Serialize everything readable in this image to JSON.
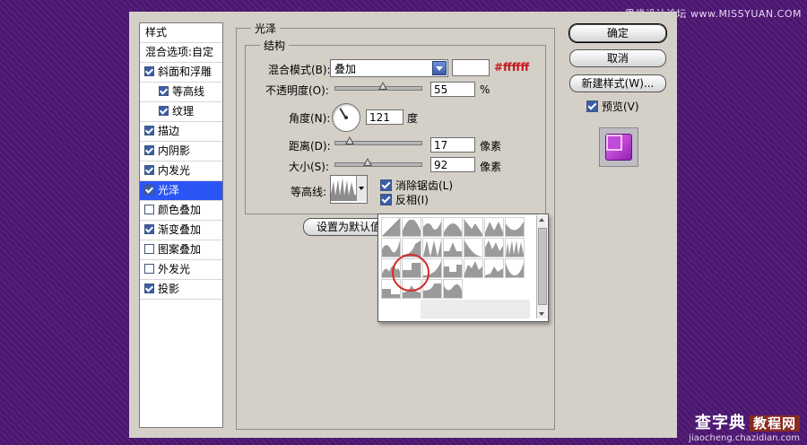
{
  "dialog": {
    "style_list": {
      "header": "样式",
      "blend_options": "混合选项:自定",
      "items": [
        {
          "label": "斜面和浮雕",
          "checked": true,
          "indent": false,
          "selected": false
        },
        {
          "label": "等高线",
          "checked": true,
          "indent": true,
          "selected": false
        },
        {
          "label": "纹理",
          "checked": true,
          "indent": true,
          "selected": false
        },
        {
          "label": "描边",
          "checked": true,
          "indent": false,
          "selected": false
        },
        {
          "label": "内阴影",
          "checked": true,
          "indent": false,
          "selected": false
        },
        {
          "label": "内发光",
          "checked": true,
          "indent": false,
          "selected": false
        },
        {
          "label": "光泽",
          "checked": true,
          "indent": false,
          "selected": true
        },
        {
          "label": "颜色叠加",
          "checked": false,
          "indent": false,
          "selected": false
        },
        {
          "label": "渐变叠加",
          "checked": true,
          "indent": false,
          "selected": false
        },
        {
          "label": "图案叠加",
          "checked": false,
          "indent": false,
          "selected": false
        },
        {
          "label": "外发光",
          "checked": false,
          "indent": false,
          "selected": false
        },
        {
          "label": "投影",
          "checked": true,
          "indent": false,
          "selected": false
        }
      ]
    },
    "panel": {
      "title": "光泽",
      "structure_title": "结构",
      "blend_mode_label": "混合模式(B):",
      "blend_mode_value": "叠加",
      "color_hex": "#ffffff",
      "opacity_label": "不透明度(O):",
      "opacity_value": "55",
      "opacity_unit": "%",
      "opacity_fraction": 0.55,
      "angle_label": "角度(N):",
      "angle_value": "121",
      "angle_unit": "度",
      "distance_label": "距离(D):",
      "distance_value": "17",
      "distance_unit": "像素",
      "distance_fraction": 0.17,
      "size_label": "大小(S):",
      "size_value": "92",
      "size_unit": "像素",
      "size_fraction": 0.37,
      "contour_label": "等高线:",
      "anti_alias_label": "消除锯齿(L)",
      "anti_alias_checked": true,
      "invert_label": "反相(I)",
      "invert_checked": true,
      "set_default_button": "设置为默认值"
    },
    "buttons": {
      "ok": "确定",
      "cancel": "取消",
      "new_style": "新建样式(W)...",
      "preview_label": "预览(V)",
      "preview_checked": true
    },
    "contour_popup": {
      "tile_count": 25,
      "highlighted_index": 13
    }
  },
  "watermarks": {
    "top": "思缘设计论坛 www.MISSYUAN.COM",
    "bottom_main": "查字典",
    "bottom_tag": "教程网",
    "bottom_url": "jiaocheng.chazidian.com"
  },
  "colors": {
    "background": "#4b1670",
    "dialog": "#d4d0c8",
    "selection": "#2b54f5",
    "hex_text": "#c8141e",
    "highlight_ring": "#d42a2a"
  }
}
